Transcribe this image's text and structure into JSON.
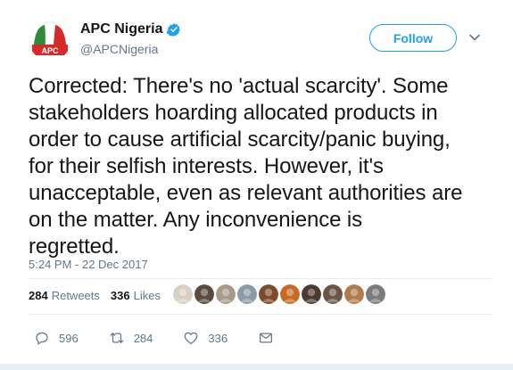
{
  "account": {
    "display_name": "APC Nigeria",
    "handle": "@APCNigeria",
    "avatar_text": "APC",
    "verified": true
  },
  "follow_label": "Follow",
  "tweet": {
    "text": "Corrected: There's no 'actual scarcity'. Some\nstakeholders hoarding allocated products in\norder to cause artificial scarcity/panic buying,\nfor their selfish interests. However, it's\nunacceptable, even as relevant authorities are\non the matter. Any inconvenience is\nregretted.",
    "timestamp": "5:24 PM - 22 Dec 2017"
  },
  "stats": {
    "retweets_count": "284",
    "retweets_label": "Retweets",
    "likes_count": "336",
    "likes_label": "Likes"
  },
  "liker_avatars": [
    "#d9d0c4",
    "#5a4a3e",
    "#a79a8c",
    "#8a9aa6",
    "#7c4b2a",
    "#c86a23",
    "#4b3a2f",
    "#6b5646",
    "#b07b4e",
    "#7b7b7b"
  ],
  "actions": {
    "reply_count": "596",
    "retweet_count": "284",
    "like_count": "336"
  },
  "icons": {
    "verified": "verified-badge-icon",
    "caret": "chevron-down-icon",
    "reply": "reply-icon",
    "retweet": "retweet-icon",
    "like": "heart-icon",
    "message": "envelope-icon"
  },
  "colors": {
    "accent": "#1da1f2",
    "text": "#14171a",
    "muted": "#657786",
    "avatar_green": "#2e8b3c",
    "avatar_red": "#d62a2a"
  }
}
